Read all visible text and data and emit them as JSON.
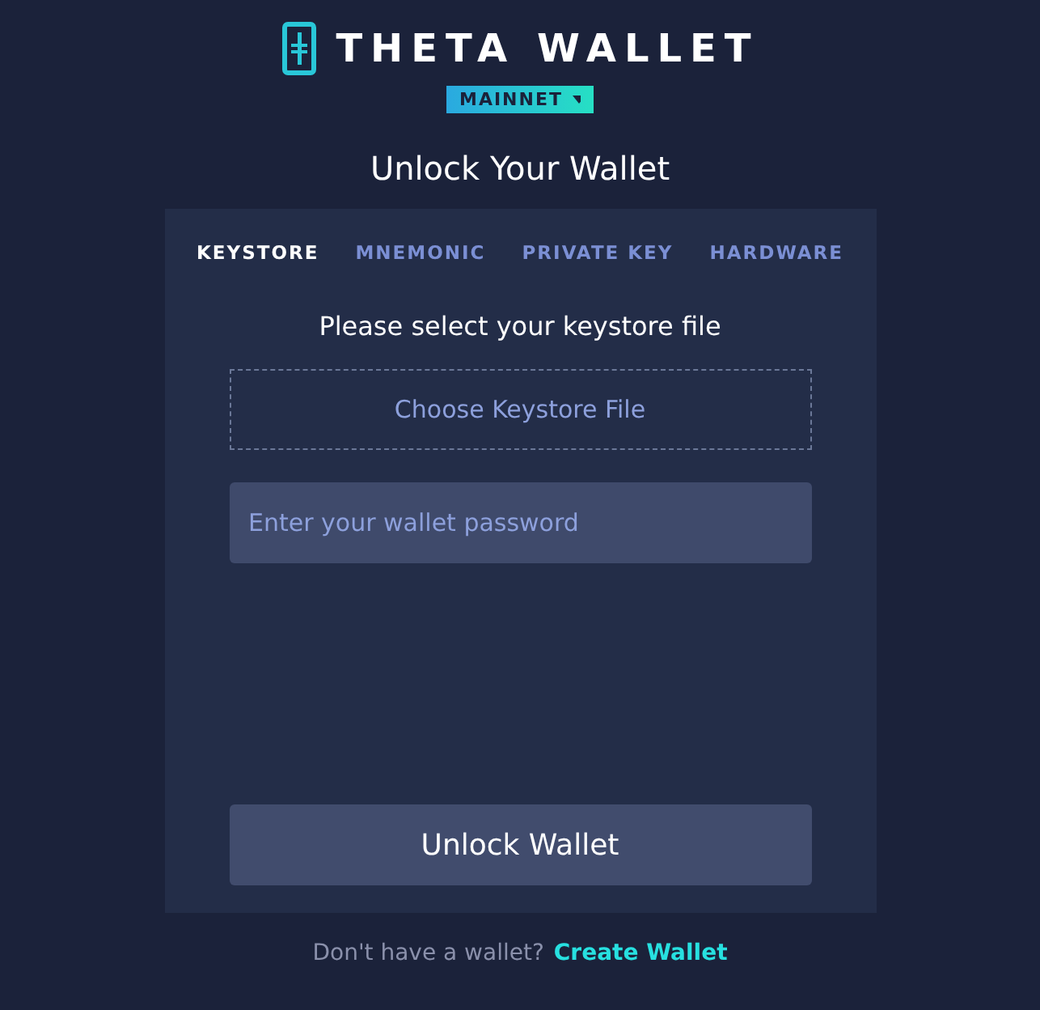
{
  "logo": {
    "text": "THETA WALLET"
  },
  "network": {
    "label": "MAINNET"
  },
  "title": "Unlock Your Wallet",
  "tabs": [
    {
      "label": "KEYSTORE",
      "selected": true
    },
    {
      "label": "MNEMONIC",
      "selected": false
    },
    {
      "label": "PRIVATE KEY",
      "selected": false
    },
    {
      "label": "HARDWARE",
      "selected": false
    }
  ],
  "prompt": "Please select your keystore file",
  "file_button": "Choose Keystore File",
  "password": {
    "placeholder": "Enter your wallet password"
  },
  "unlock_button": "Unlock Wallet",
  "footer": {
    "text": "Don't have a wallet?",
    "link": "Create Wallet"
  }
}
